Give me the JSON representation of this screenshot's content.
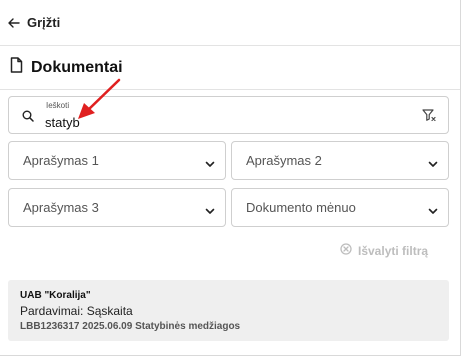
{
  "header": {
    "back_label": "Grįžti"
  },
  "page": {
    "title": "Dokumentai"
  },
  "search": {
    "label": "Ieškoti",
    "value": "statyb"
  },
  "filters": {
    "description1": "Aprašymas 1",
    "description2": "Aprašymas 2",
    "description3": "Aprašymas 3",
    "document_month": "Dokumento mėnuo",
    "clear_label": "Išvalyti filtrą"
  },
  "results": [
    {
      "company": "UAB \"Koralija\"",
      "doc_type": "Pardavimai: Sąskaita",
      "meta": "LBB1236317 2025.06.09 Statybinės medžiagos"
    }
  ],
  "colors": {
    "annotation_arrow": "#e02020",
    "card_background": "#efefef",
    "disabled_text": "#bdbdbd"
  }
}
